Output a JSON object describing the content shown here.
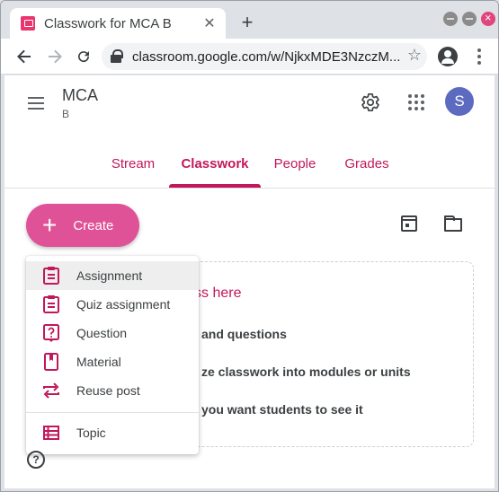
{
  "browser": {
    "tab_title": "Classwork for MCA B",
    "url": "classroom.google.com/w/NjkxMDE3NzczM..."
  },
  "classroom": {
    "class_name": "MCA",
    "section": "B",
    "avatar_letter": "S",
    "tabs": [
      {
        "label": "Stream"
      },
      {
        "label": "Classwork"
      },
      {
        "label": "People"
      },
      {
        "label": "Grades"
      }
    ],
    "active_tab": "Classwork",
    "create_label": "Create",
    "menu": [
      {
        "label": "Assignment",
        "icon": "assignment-icon"
      },
      {
        "label": "Quiz assignment",
        "icon": "quiz-icon"
      },
      {
        "label": "Question",
        "icon": "question-icon"
      },
      {
        "label": "Material",
        "icon": "material-icon"
      },
      {
        "label": "Reuse post",
        "icon": "repeat-icon"
      },
      {
        "label": "Topic",
        "icon": "topic-icon"
      }
    ],
    "card": {
      "title": "ss here",
      "lines": [
        "and questions",
        "ze classwork into modules or units",
        "you want students to see it"
      ]
    }
  },
  "colors": {
    "accent": "#c2185b",
    "create_button": "#e05297",
    "avatar": "#5c6bc0"
  }
}
